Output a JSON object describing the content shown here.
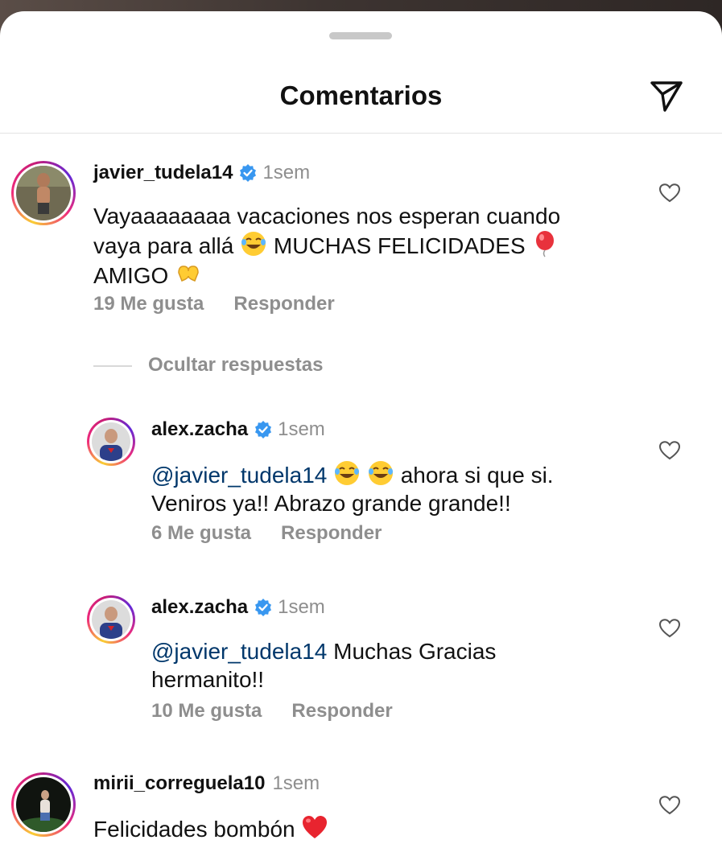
{
  "header": {
    "title": "Comentarios",
    "share_icon": "send-icon"
  },
  "comments": [
    {
      "username": "javier_tudela14",
      "verified": true,
      "time": "1sem",
      "text_parts": [
        "Vayaaaaaaaa vacaciones nos esperan cuando",
        "vaya para allá",
        "MUCHAS FELICIDADES",
        "AMIGO"
      ],
      "emojis": [
        "😂",
        "🎈",
        "🫶"
      ],
      "likes": "19 Me gusta",
      "reply": "Responder"
    },
    {
      "username": "alex.zacha",
      "verified": true,
      "time": "1sem",
      "mention": "@javier_tudela14",
      "text_parts": [
        "ahora si que si.",
        "Veniros ya!! Abrazo grande grande!!"
      ],
      "emojis": [
        "😂",
        "😂"
      ],
      "likes": "6 Me gusta",
      "reply": "Responder"
    },
    {
      "username": "alex.zacha",
      "verified": true,
      "time": "1sem",
      "mention": "@javier_tudela14",
      "text_parts": [
        "Muchas Gracias",
        "hermanito!!"
      ],
      "likes": "10 Me gusta",
      "reply": "Responder"
    },
    {
      "username": "mirii_correguela10",
      "verified": false,
      "time": "1sem",
      "text_parts": [
        "Felicidades bombón"
      ],
      "emojis": [
        "❤️"
      ]
    }
  ],
  "thread": {
    "hide_replies": "Ocultar respuestas"
  },
  "colors": {
    "verified": "#3897f0",
    "mention": "#00376b",
    "secondary_text": "#8e8e8e"
  }
}
